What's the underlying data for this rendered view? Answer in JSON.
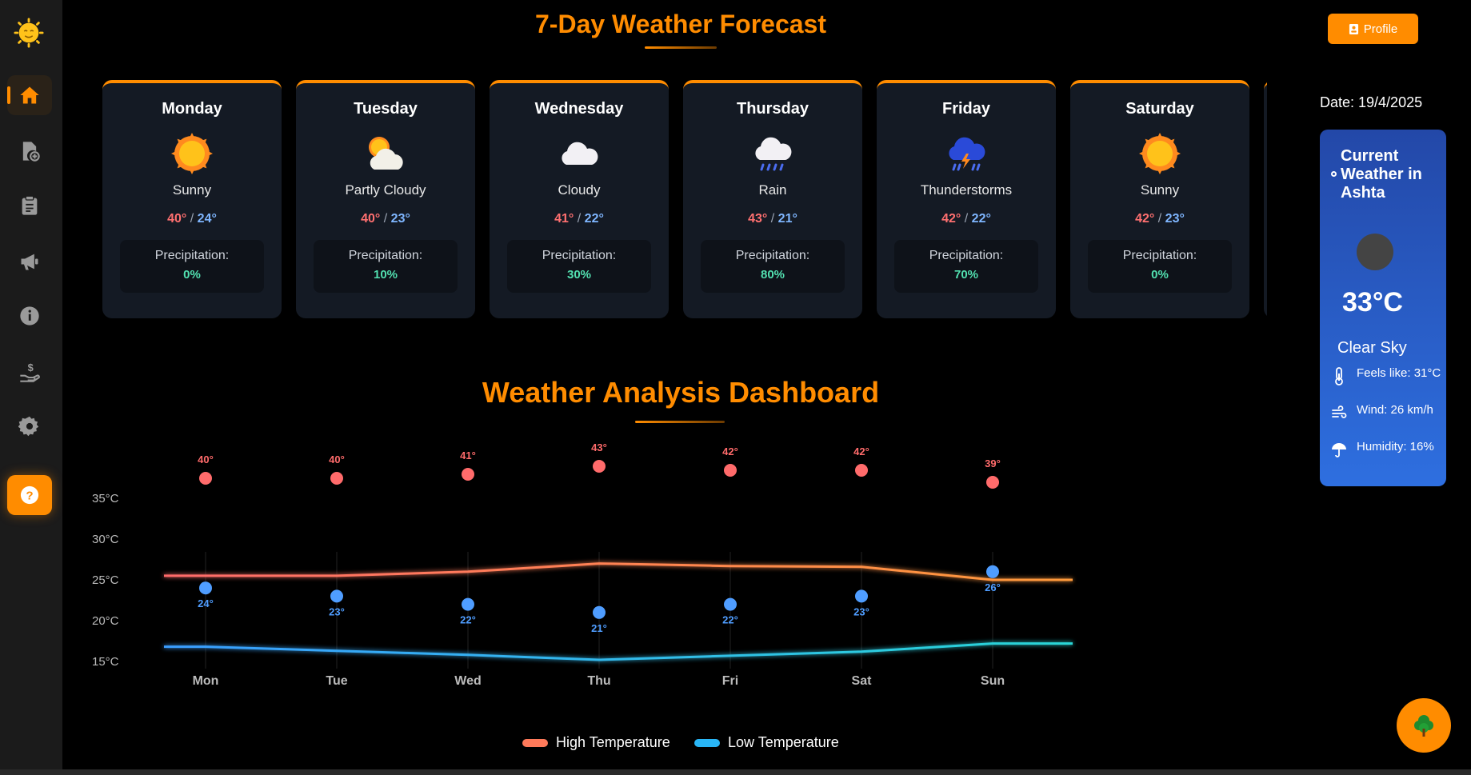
{
  "header": {
    "title": "7-Day Weather Forecast",
    "profile_label": "Profile"
  },
  "sidebar": {
    "items": [
      {
        "name": "home",
        "icon": "home-icon",
        "active": true
      },
      {
        "name": "add-file",
        "icon": "file-add-icon"
      },
      {
        "name": "clipboard",
        "icon": "clipboard-icon"
      },
      {
        "name": "announcements",
        "icon": "megaphone-icon"
      },
      {
        "name": "info",
        "icon": "info-icon"
      },
      {
        "name": "payments",
        "icon": "hand-dollar-icon"
      },
      {
        "name": "settings",
        "icon": "gear-icon"
      },
      {
        "name": "help",
        "icon": "question-icon"
      }
    ]
  },
  "forecast": [
    {
      "day": "Monday",
      "condition": "Sunny",
      "icon": "sun-icon",
      "high": "40°",
      "low": "24°",
      "precip_label": "Precipitation:",
      "precip": "0%"
    },
    {
      "day": "Tuesday",
      "condition": "Partly Cloudy",
      "icon": "partly-cloudy-icon",
      "high": "40°",
      "low": "23°",
      "precip_label": "Precipitation:",
      "precip": "10%"
    },
    {
      "day": "Wednesday",
      "condition": "Cloudy",
      "icon": "cloud-icon",
      "high": "41°",
      "low": "22°",
      "precip_label": "Precipitation:",
      "precip": "30%"
    },
    {
      "day": "Thursday",
      "condition": "Rain",
      "icon": "rain-icon",
      "high": "43°",
      "low": "21°",
      "precip_label": "Precipitation:",
      "precip": "80%"
    },
    {
      "day": "Friday",
      "condition": "Thunderstorms",
      "icon": "thunderstorm-icon",
      "high": "42°",
      "low": "22°",
      "precip_label": "Precipitation:",
      "precip": "70%"
    },
    {
      "day": "Saturday",
      "condition": "Sunny",
      "icon": "sun-icon",
      "high": "42°",
      "low": "23°",
      "precip_label": "Precipitation:",
      "precip": "0%"
    }
  ],
  "current": {
    "date": "Date: 19/4/2025",
    "title": "Current Weather in Ashta",
    "temperature": "33°C",
    "description": "Clear Sky",
    "feels_like": "Feels like: 31°C",
    "wind": "Wind: 26 km/h",
    "humidity": "Humidity: 16%"
  },
  "dashboard": {
    "title": "Weather Analysis Dashboard"
  },
  "colors": {
    "accent": "#ff8c00",
    "high": "#ff6b6b",
    "low": "#4f9dff",
    "precip": "#52e0b0"
  },
  "chart_data": {
    "type": "line",
    "categories": [
      "Mon",
      "Tue",
      "Wed",
      "Thu",
      "Fri",
      "Sat",
      "Sun"
    ],
    "y_ticks": [
      "35°C",
      "30°C",
      "25°C",
      "20°C",
      "15°C"
    ],
    "ylim": [
      15,
      35
    ],
    "ranges": [
      {
        "high": 40,
        "low": 24,
        "high_label": "40°",
        "low_label": "24°"
      },
      {
        "high": 40,
        "low": 23,
        "high_label": "40°",
        "low_label": "23°"
      },
      {
        "high": 41,
        "low": 22,
        "high_label": "41°",
        "low_label": "22°"
      },
      {
        "high": 43,
        "low": 21,
        "high_label": "43°",
        "low_label": "21°"
      },
      {
        "high": 42,
        "low": 22,
        "high_label": "42°",
        "low_label": "22°"
      },
      {
        "high": 42,
        "low": 23,
        "high_label": "42°",
        "low_label": "23°"
      },
      {
        "high": 39,
        "low": 26,
        "high_label": "39°",
        "low_label": "26°"
      }
    ],
    "series": [
      {
        "name": "High Temperature",
        "color": "#ff6b6b",
        "values": [
          25.5,
          25.5,
          26.0,
          27.0,
          26.7,
          26.6,
          25.0
        ]
      },
      {
        "name": "Low Temperature",
        "color": "#29b6f6",
        "values": [
          16.8,
          16.3,
          15.8,
          15.2,
          15.7,
          16.2,
          17.2
        ]
      }
    ]
  }
}
